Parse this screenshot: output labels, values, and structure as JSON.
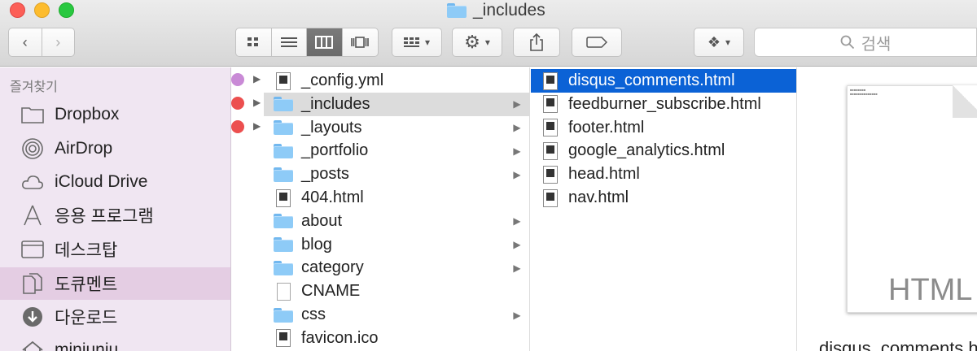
{
  "window": {
    "title": "_includes"
  },
  "toolbar": {
    "search_placeholder": "검색"
  },
  "sidebar": {
    "heading": "즐겨찾기",
    "items": [
      {
        "label": "Dropbox",
        "icon": "folder-icon"
      },
      {
        "label": "AirDrop",
        "icon": "airdrop-icon"
      },
      {
        "label": "iCloud Drive",
        "icon": "cloud-icon"
      },
      {
        "label": "응용 프로그램",
        "icon": "applications-icon"
      },
      {
        "label": "데스크탑",
        "icon": "desktop-icon"
      },
      {
        "label": "도큐멘트",
        "icon": "documents-icon"
      },
      {
        "label": "다운로드",
        "icon": "download-icon"
      },
      {
        "label": "minjunju",
        "icon": "home-icon"
      }
    ]
  },
  "tags": [
    {
      "row": 0,
      "color": "#c98ad6"
    },
    {
      "row": 1,
      "color": "#ec4f4f"
    },
    {
      "row": 2,
      "color": "#ec4f4f"
    }
  ],
  "column1": [
    {
      "name": "_config.yml",
      "kind": "file",
      "folder": false
    },
    {
      "name": "_includes",
      "kind": "folder",
      "folder": true
    },
    {
      "name": "_layouts",
      "kind": "folder",
      "folder": true
    },
    {
      "name": "_portfolio",
      "kind": "folder",
      "folder": true
    },
    {
      "name": "_posts",
      "kind": "folder",
      "folder": true
    },
    {
      "name": "404.html",
      "kind": "file",
      "folder": false
    },
    {
      "name": "about",
      "kind": "folder",
      "folder": true
    },
    {
      "name": "blog",
      "kind": "folder",
      "folder": true
    },
    {
      "name": "category",
      "kind": "folder",
      "folder": true
    },
    {
      "name": "CNAME",
      "kind": "plain",
      "folder": false
    },
    {
      "name": "css",
      "kind": "folder",
      "folder": true
    },
    {
      "name": "favicon.ico",
      "kind": "file",
      "folder": false
    }
  ],
  "column2": [
    {
      "name": "disqus_comments.html",
      "kind": "file"
    },
    {
      "name": "feedburner_subscribe.html",
      "kind": "file"
    },
    {
      "name": "footer.html",
      "kind": "file"
    },
    {
      "name": "google_analytics.html",
      "kind": "file"
    },
    {
      "name": "head.html",
      "kind": "file"
    },
    {
      "name": "nav.html",
      "kind": "file"
    }
  ],
  "preview": {
    "type_label": "HTML",
    "caption": "disqus_comments.html"
  },
  "colors": {
    "selection_blue": "#0b62d6",
    "sidebar_bg": "#f0e6f2"
  }
}
